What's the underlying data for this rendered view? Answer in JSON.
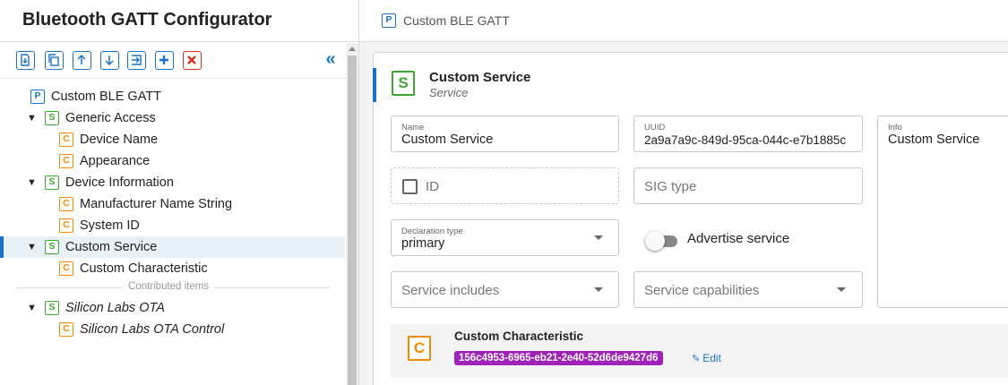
{
  "app": {
    "title": "Bluetooth GATT Configurator"
  },
  "toolbar": {
    "buttons": [
      "import-button",
      "copy-button",
      "move-up-button",
      "move-down-button",
      "export-button",
      "add-button",
      "delete-button"
    ],
    "collapse_glyph": "«"
  },
  "tree": {
    "items": [
      {
        "badge": "P",
        "label": "Custom BLE GATT"
      },
      {
        "badge": "S",
        "label": "Generic Access"
      },
      {
        "badge": "C",
        "label": "Device Name"
      },
      {
        "badge": "C",
        "label": "Appearance"
      },
      {
        "badge": "S",
        "label": "Device Information"
      },
      {
        "badge": "C",
        "label": "Manufacturer Name String"
      },
      {
        "badge": "C",
        "label": "System ID"
      },
      {
        "badge": "S",
        "label": "Custom Service"
      },
      {
        "badge": "C",
        "label": "Custom Characteristic"
      },
      {
        "badge": "S",
        "label": "Silicon Labs OTA"
      },
      {
        "badge": "C",
        "label": "Silicon Labs OTA Control"
      }
    ],
    "contributed_label": "Contributed items",
    "caret": "▼"
  },
  "header": {
    "badge": "P",
    "title": "Custom BLE GATT"
  },
  "service": {
    "badge": "S",
    "title": "Custom Service",
    "subtitle": "Service",
    "name_label": "Name",
    "name_value": "Custom Service",
    "uuid_label": "UUID",
    "uuid_value": "2a9a7a9c-849d-95ca-044c-e7b1885c",
    "info_label": "Info",
    "info_value": "Custom Service",
    "id_label": "ID",
    "sig_type_placeholder": "SIG type",
    "declaration_label": "Declaration type",
    "declaration_value": "primary",
    "advertise_label": "Advertise service",
    "advertise_on": false,
    "includes_placeholder": "Service includes",
    "capabilities_placeholder": "Service capabilities"
  },
  "characteristic": {
    "badge": "C",
    "title": "Custom Characteristic",
    "uuid": "156c4953-6965-eb21-2e40-52d6de9427d6",
    "edit_icon": "✎",
    "edit_label": "Edit"
  },
  "colors": {
    "accent": "#1a73c9",
    "service_green": "#3fa535",
    "characteristic_orange": "#f08a00",
    "uuid_purple": "#a022b8",
    "delete_red": "#d93025"
  }
}
